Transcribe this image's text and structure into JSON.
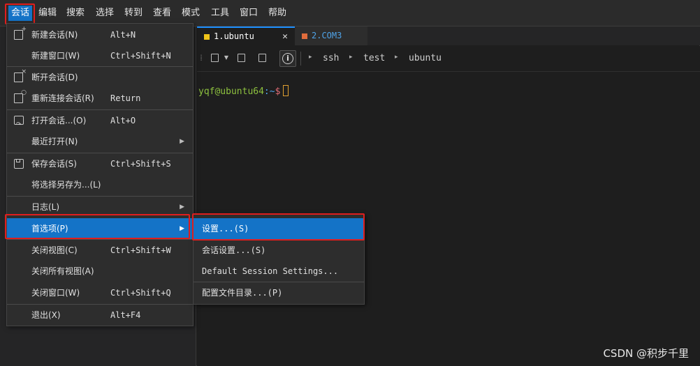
{
  "menubar": {
    "items": [
      "会话",
      "编辑",
      "搜索",
      "选择",
      "转到",
      "查看",
      "模式",
      "工具",
      "窗口",
      "帮助"
    ]
  },
  "tabs": [
    {
      "label": "1.ubuntu",
      "close": "✕",
      "color": "#f0c419"
    },
    {
      "label": "2.COM3",
      "color": "#e06c3c"
    }
  ],
  "toolbar": {
    "breadcrumb": [
      "ssh",
      "test",
      "ubuntu"
    ]
  },
  "terminal": {
    "user_host": "yqf@ubuntu64",
    "path_sep": ":~$"
  },
  "session_menu": {
    "items": [
      {
        "label": "新建会话(N)",
        "shortcut": "Alt+N"
      },
      {
        "label": "新建窗口(W)",
        "shortcut": "Ctrl+Shift+N"
      },
      {
        "label": "断开会话(D)",
        "shortcut": ""
      },
      {
        "label": "重新连接会话(R)",
        "shortcut": "Return"
      },
      {
        "label": "打开会话...(O)",
        "shortcut": "Alt+O"
      },
      {
        "label": "最近打开(N)",
        "shortcut": ""
      },
      {
        "label": "保存会话(S)",
        "shortcut": "Ctrl+Shift+S"
      },
      {
        "label": "将选择另存为...(L)",
        "shortcut": ""
      },
      {
        "label": "日志(L)",
        "shortcut": ""
      },
      {
        "label": "首选项(P)",
        "shortcut": ""
      },
      {
        "label": "关闭视图(C)",
        "shortcut": "Ctrl+Shift+W"
      },
      {
        "label": "关闭所有视图(A)",
        "shortcut": ""
      },
      {
        "label": "关闭窗口(W)",
        "shortcut": "Ctrl+Shift+Q"
      },
      {
        "label": "退出(X)",
        "shortcut": "Alt+F4"
      }
    ]
  },
  "preferences_submenu": {
    "items": [
      "设置...(S)",
      "会话设置...(S)",
      "Default Session Settings...",
      "配置文件目录...(P)"
    ]
  },
  "watermark": "CSDN @积步千里",
  "colors": {
    "accent": "#1473c7",
    "highlight_box": "#e01e1e",
    "prompt_user": "#8ec23f",
    "prompt_path": "#4fa3e8",
    "prompt_dollar": "#e06c75"
  }
}
